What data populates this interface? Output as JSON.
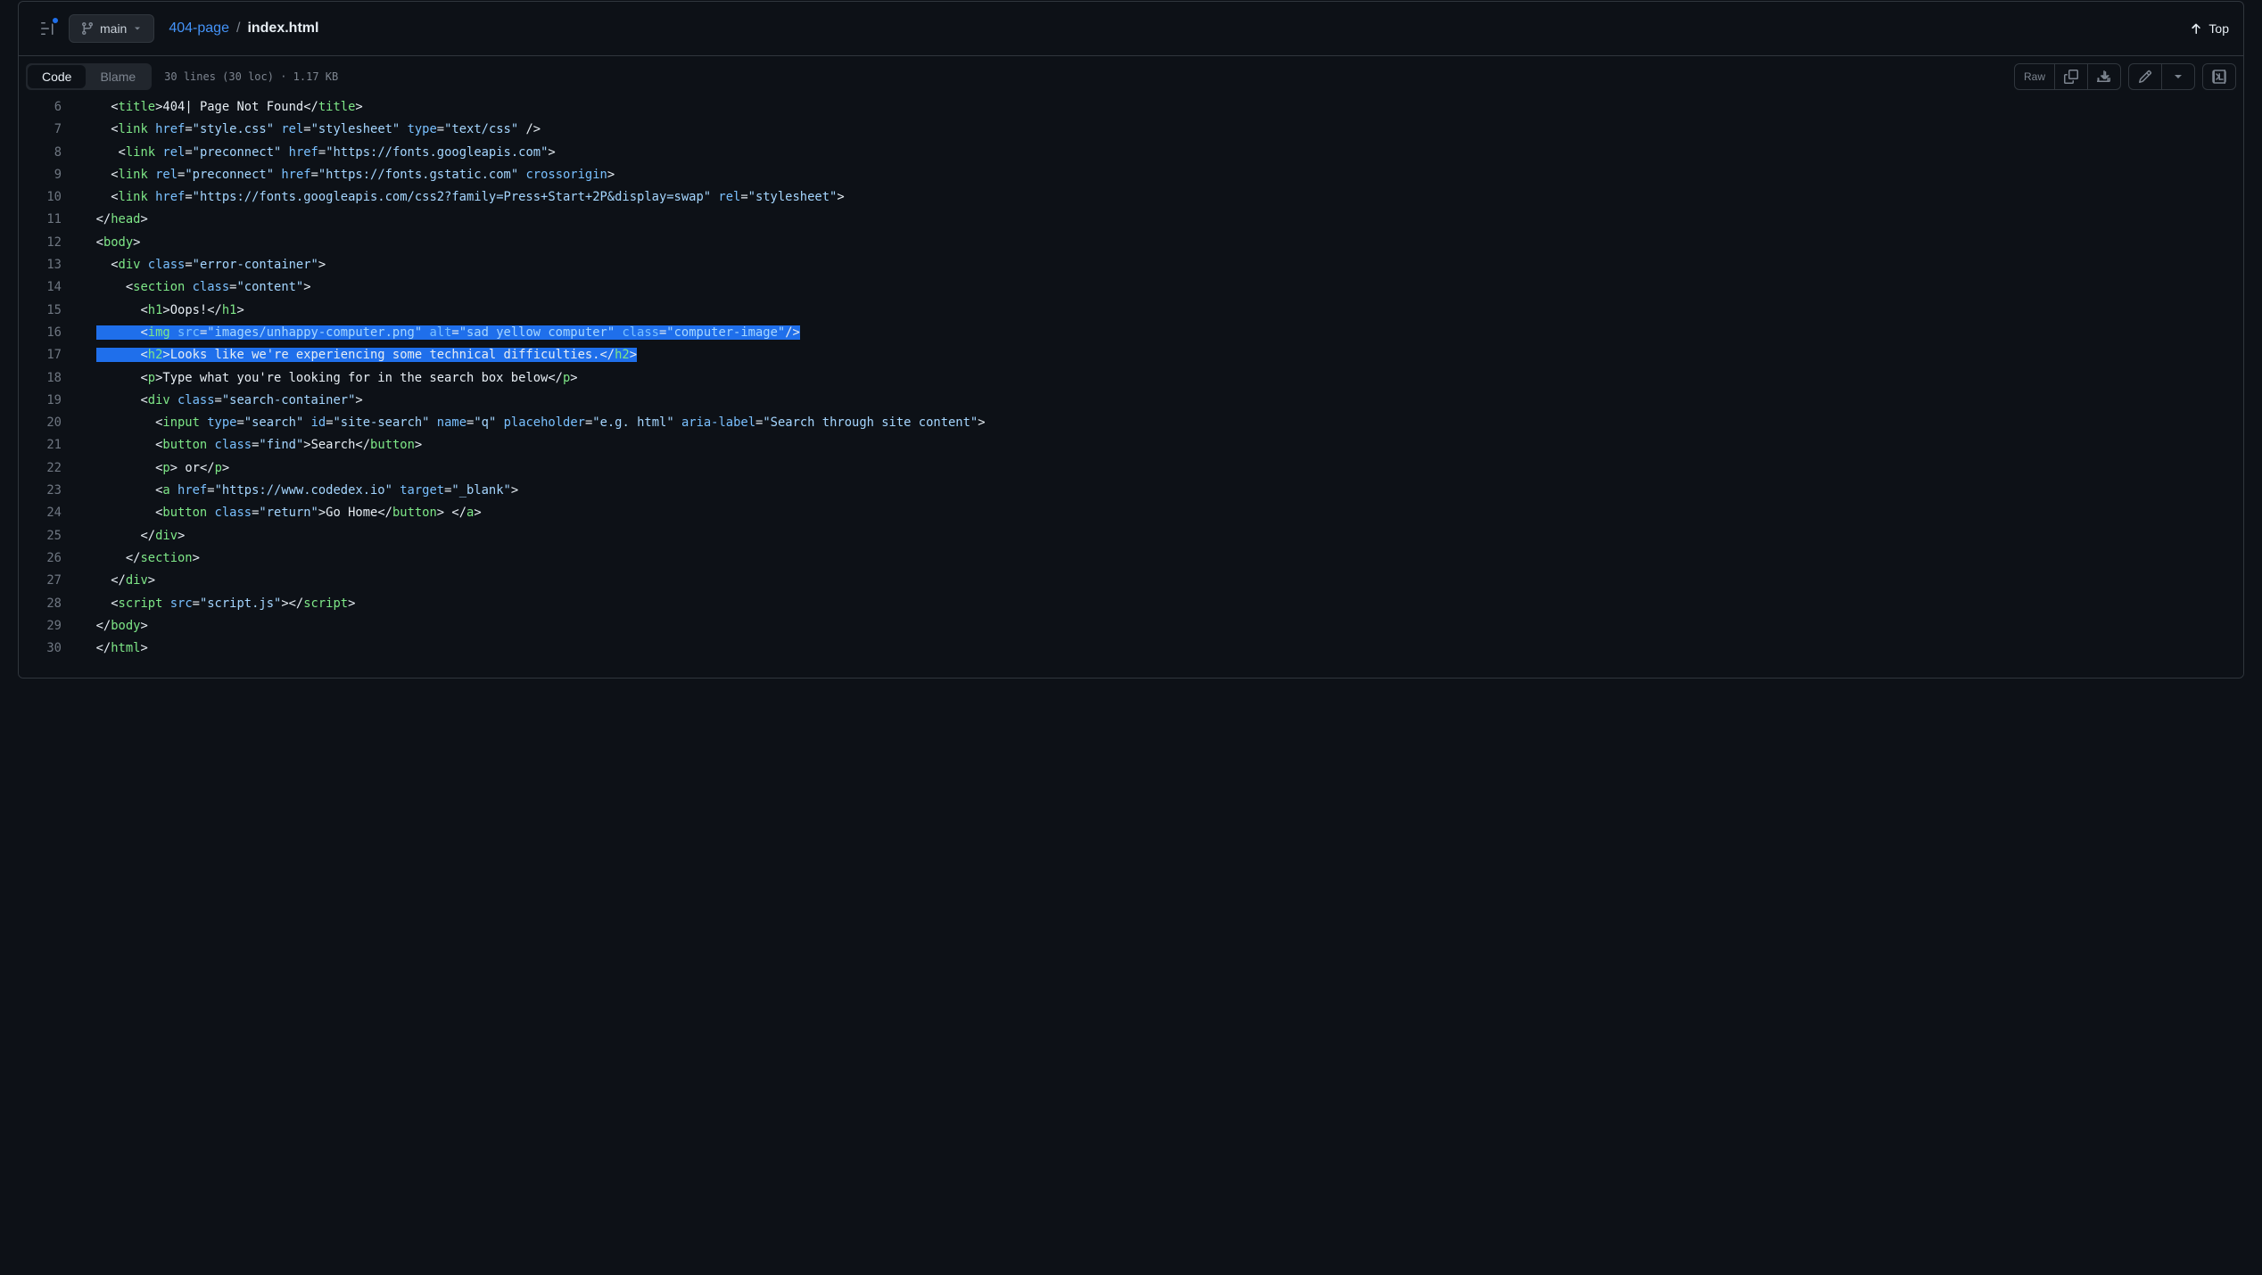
{
  "branch": "main",
  "breadcrumb": {
    "dir": "404-page",
    "sep": "/",
    "file": "index.html"
  },
  "top_link": "Top",
  "tabs": {
    "code": "Code",
    "blame": "Blame"
  },
  "file_info": "30 lines (30 loc) · 1.17 KB",
  "raw_label": "Raw",
  "code": {
    "6": {
      "indent": "    ",
      "open": "title",
      "text": "404| Page Not Found",
      "close": "title"
    },
    "7": {
      "indent": "    ",
      "tag": "link",
      "attrs": [
        [
          "href",
          "style.css"
        ],
        [
          "rel",
          "stylesheet"
        ],
        [
          "type",
          "text/css"
        ]
      ],
      "selfclose": " />"
    },
    "8": {
      "indent": "     ",
      "tag": "link",
      "attrs": [
        [
          "rel",
          "preconnect"
        ],
        [
          "href",
          "https://fonts.googleapis.com"
        ]
      ],
      "selfclose": ">"
    },
    "9": {
      "indent": "    ",
      "tag": "link",
      "attrs": [
        [
          "rel",
          "preconnect"
        ],
        [
          "href",
          "https://fonts.gstatic.com"
        ]
      ],
      "flag": "crossorigin",
      "selfclose": ">"
    },
    "10": {
      "indent": "    ",
      "tag": "link",
      "attrs": [
        [
          "href",
          "https://fonts.googleapis.com/css2?family=Press+Start+2P&display=swap"
        ],
        [
          "rel",
          "stylesheet"
        ]
      ],
      "selfclose": ">"
    },
    "11": {
      "indent": "  ",
      "closetag": "head"
    },
    "12": {
      "indent": "  ",
      "opentag": "body"
    },
    "13": {
      "indent": "    ",
      "tag": "div",
      "attrs": [
        [
          "class",
          "error-container"
        ]
      ],
      "selfclose": ">"
    },
    "14": {
      "indent": "      ",
      "tag": "section",
      "attrs": [
        [
          "class",
          "content"
        ]
      ],
      "selfclose": ">"
    },
    "15": {
      "indent": "        ",
      "open": "h1",
      "text": "Oops!",
      "close": "h1"
    },
    "16": {
      "indent": "        ",
      "tag": "img",
      "attrs": [
        [
          "src",
          "images/unhappy-computer.png"
        ],
        [
          "alt",
          "sad yellow computer"
        ],
        [
          "class",
          "computer-image"
        ]
      ],
      "selfclose": "/>"
    },
    "17": {
      "indent": "        ",
      "open": "h2",
      "text": "Looks like we're experiencing some technical difficulties.",
      "close": "h2"
    },
    "18": {
      "indent": "        ",
      "open": "p",
      "text": "Type what you're looking for in the search box below",
      "close": "p"
    },
    "19": {
      "indent": "        ",
      "tag": "div",
      "attrs": [
        [
          "class",
          "search-container"
        ]
      ],
      "selfclose": ">"
    },
    "20": {
      "indent": "          ",
      "tag": "input",
      "attrs": [
        [
          "type",
          "search"
        ],
        [
          "id",
          "site-search"
        ],
        [
          "name",
          "q"
        ],
        [
          "placeholder",
          "e.g. html"
        ],
        [
          "aria-label",
          "Search through site content"
        ]
      ],
      "selfclose": ">"
    },
    "21": {
      "indent": "          ",
      "tagopen": "button",
      "tagattrs": [
        [
          "class",
          "find"
        ]
      ],
      "text": "Search",
      "close": "button"
    },
    "22": {
      "indent": "          ",
      "open": "p",
      "text": " or",
      "close": "p"
    },
    "23": {
      "indent": "          ",
      "tag": "a",
      "attrs": [
        [
          "href",
          "https://www.codedex.io"
        ],
        [
          "target",
          "_blank"
        ]
      ],
      "selfclose": ">"
    },
    "24": {
      "indent": "          ",
      "tagopen": "button",
      "tagattrs": [
        [
          "class",
          "return"
        ]
      ],
      "text": "Go Home",
      "close": "button",
      "trailclose": "a"
    },
    "25": {
      "indent": "        ",
      "closetag": "div"
    },
    "26": {
      "indent": "      ",
      "closetag": "section"
    },
    "27": {
      "indent": "    ",
      "closetag": "div"
    },
    "28": {
      "indent": "    ",
      "tag": "script",
      "attrs": [
        [
          "src",
          "script.js"
        ]
      ],
      "selfclose": ">",
      "immediateclose": "script"
    },
    "29": {
      "indent": "  ",
      "closetag": "body"
    },
    "30": {
      "indent": "  ",
      "closetag": "html"
    }
  },
  "highlighted_lines": [
    16,
    17
  ],
  "line_start": 6,
  "line_end": 30
}
